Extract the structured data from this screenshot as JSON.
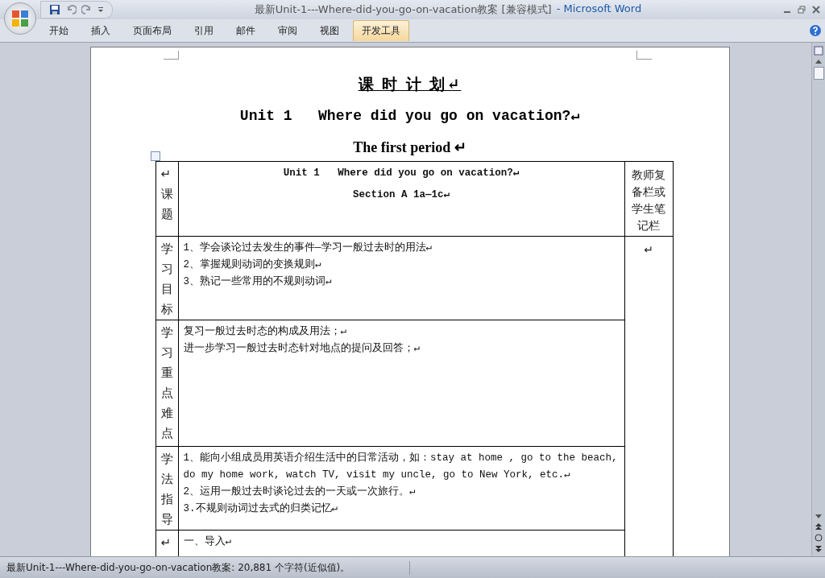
{
  "window": {
    "title": "最新Unit-1---Where-did-you-go-on-vacation教案 [兼容模式]",
    "app": "- Microsoft Word"
  },
  "tabs": [
    {
      "label": "开始",
      "selected": false
    },
    {
      "label": "插入",
      "selected": false
    },
    {
      "label": "页面布局",
      "selected": false
    },
    {
      "label": "引用",
      "selected": false
    },
    {
      "label": "邮件",
      "selected": false
    },
    {
      "label": "审阅",
      "selected": false
    },
    {
      "label": "视图",
      "selected": false
    },
    {
      "label": "开发工具",
      "selected": true
    }
  ],
  "document": {
    "title": "课 时 计 划↵",
    "unit_heading": "Unit 1   Where did you go on vacation?↵",
    "period": "The first period ↵",
    "table": {
      "rows": [
        {
          "label": "↵课题",
          "lines": [
            "Unit 1   Where did you go on vacation?↵",
            "Section A 1a—1c↵"
          ],
          "centered": true,
          "notes": "教师复备栏或学生笔记栏"
        },
        {
          "label": "学习目标",
          "lines": [
            "1、学会谈论过去发生的事件—学习一般过去时的用法↵",
            "2、掌握规则动词的变换规则↵",
            "3、熟记一些常用的不规则动词↵"
          ],
          "centered": false,
          "notes": "↵"
        },
        {
          "label": "学习重点难点",
          "lines": [
            "复习一般过去时态的构成及用法；↵",
            "进一步学习一般过去时态针对地点的提问及回答；↵"
          ],
          "centered": false
        },
        {
          "label": "学法指导",
          "lines": [
            "1、能向小组成员用英语介绍生活中的日常活动，如：stay at home , go to the beach, do my home work, watch TV, visit my uncle, go to New York, etc.↵",
            "2、运用一般过去时谈论过去的一天或一次旅行。↵",
            "3.不规则动词过去式的归类记忆↵"
          ],
          "centered": false
        },
        {
          "label": "↵",
          "lines": [
            "一、导入↵"
          ],
          "centered": false
        }
      ]
    }
  },
  "status_bar": {
    "text": "最新Unit-1---Where-did-you-go-on-vacation教案: 20,881 个字符(近似值)。"
  }
}
